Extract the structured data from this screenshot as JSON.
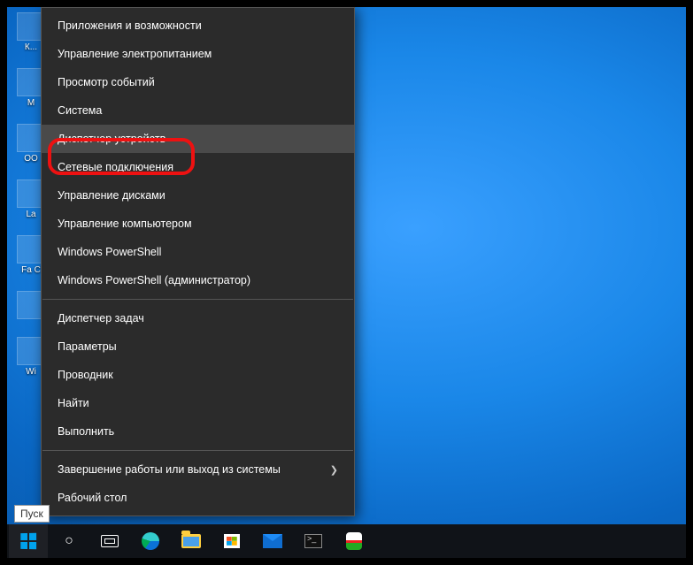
{
  "desktop_icon_labels": [
    "К...",
    "M",
    "OO",
    "La",
    "Fa C",
    "",
    "Wi"
  ],
  "winx_menu": {
    "sections": [
      [
        "Приложения и возможности",
        "Управление электропитанием",
        "Просмотр событий",
        "Система",
        "Диспетчер устройств",
        "Сетевые подключения",
        "Управление дисками",
        "Управление компьютером",
        "Windows PowerShell",
        "Windows PowerShell (администратор)"
      ],
      [
        "Диспетчер задач",
        "Параметры",
        "Проводник",
        "Найти",
        "Выполнить"
      ],
      [
        "Завершение работы или выход из системы",
        "Рабочий стол"
      ]
    ],
    "highlighted_index": 4,
    "submenu_item": "Завершение работы или выход из системы"
  },
  "start_tooltip": "Пуск",
  "taskbar": {
    "buttons": [
      "start",
      "search",
      "taskview",
      "edge",
      "explorer",
      "store",
      "mail",
      "cmd",
      "app"
    ]
  }
}
